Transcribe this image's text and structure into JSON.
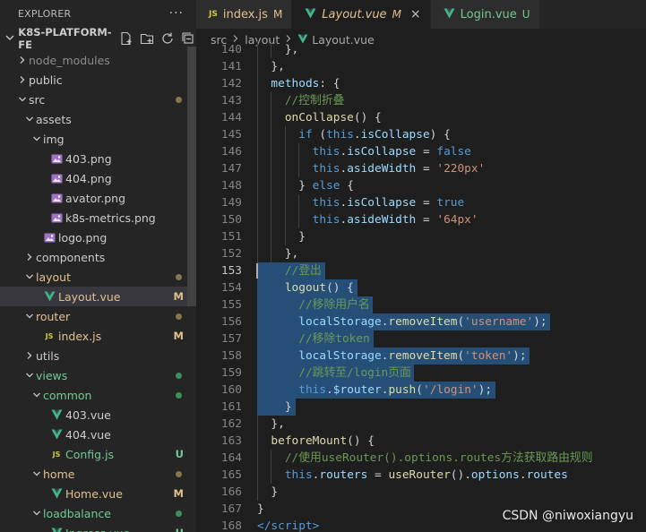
{
  "sidebar": {
    "title": "EXPLORER",
    "more": "···",
    "project": "K8S-PLATFORM-FE",
    "tree": [
      {
        "label": "node_modules",
        "depth": 1,
        "kind": "folder",
        "open": false,
        "color": "#8c8c8c"
      },
      {
        "label": "public",
        "depth": 1,
        "kind": "folder",
        "open": false,
        "color": "#cccccc"
      },
      {
        "label": "src",
        "depth": 1,
        "kind": "folder",
        "open": true,
        "color": "#cccccc",
        "dot": "#8c7350"
      },
      {
        "label": "assets",
        "depth": 2,
        "kind": "folder",
        "open": true,
        "color": "#cccccc"
      },
      {
        "label": "img",
        "depth": 3,
        "kind": "folder",
        "open": true,
        "color": "#cccccc"
      },
      {
        "label": "403.png",
        "depth": 4,
        "kind": "image",
        "color": "#cccccc"
      },
      {
        "label": "404.png",
        "depth": 4,
        "kind": "image",
        "color": "#cccccc"
      },
      {
        "label": "avator.png",
        "depth": 4,
        "kind": "image",
        "color": "#cccccc"
      },
      {
        "label": "k8s-metrics.png",
        "depth": 4,
        "kind": "image",
        "color": "#cccccc"
      },
      {
        "label": "logo.png",
        "depth": 3,
        "kind": "image",
        "color": "#cccccc"
      },
      {
        "label": "components",
        "depth": 2,
        "kind": "folder",
        "open": false,
        "color": "#cccccc"
      },
      {
        "label": "layout",
        "depth": 2,
        "kind": "folder",
        "open": true,
        "color": "#e2c08d",
        "dot": "#8c7350"
      },
      {
        "label": "Layout.vue",
        "depth": 3,
        "kind": "vue",
        "color": "#e2c08d",
        "badge": "M",
        "badgeColor": "#e2c08d",
        "selected": true
      },
      {
        "label": "router",
        "depth": 2,
        "kind": "folder",
        "open": true,
        "color": "#e2c08d",
        "dot": "#8c7350"
      },
      {
        "label": "index.js",
        "depth": 3,
        "kind": "js",
        "color": "#e2c08d",
        "badge": "M",
        "badgeColor": "#e2c08d"
      },
      {
        "label": "utils",
        "depth": 2,
        "kind": "folder",
        "open": false,
        "color": "#cccccc"
      },
      {
        "label": "views",
        "depth": 2,
        "kind": "folder",
        "open": true,
        "color": "#73c991",
        "dot": "#3f8f5a"
      },
      {
        "label": "common",
        "depth": 3,
        "kind": "folder",
        "open": true,
        "color": "#73c991",
        "dot": "#3f8f5a"
      },
      {
        "label": "403.vue",
        "depth": 4,
        "kind": "vue",
        "color": "#cccccc"
      },
      {
        "label": "404.vue",
        "depth": 4,
        "kind": "vue",
        "color": "#cccccc"
      },
      {
        "label": "Config.js",
        "depth": 4,
        "kind": "js",
        "color": "#73c991",
        "badge": "U",
        "badgeColor": "#73c991"
      },
      {
        "label": "home",
        "depth": 3,
        "kind": "folder",
        "open": true,
        "color": "#e2c08d",
        "dot": "#8c7350"
      },
      {
        "label": "Home.vue",
        "depth": 4,
        "kind": "vue",
        "color": "#e2c08d",
        "badge": "M",
        "badgeColor": "#e2c08d"
      },
      {
        "label": "loadbalance",
        "depth": 3,
        "kind": "folder",
        "open": true,
        "color": "#73c991",
        "dot": "#3f8f5a"
      },
      {
        "label": "Ingress.vue",
        "depth": 4,
        "kind": "vue",
        "color": "#73c991",
        "badge": "U",
        "badgeColor": "#73c991"
      }
    ]
  },
  "tabs": [
    {
      "label": "index.js",
      "status": "M",
      "icon": "js",
      "active": false,
      "italic": false
    },
    {
      "label": "Layout.vue",
      "status": "M",
      "icon": "vue",
      "active": true,
      "italic": true,
      "close": "×"
    },
    {
      "label": "Login.vue",
      "status": "U",
      "icon": "vue",
      "active": false,
      "italic": false
    }
  ],
  "breadcrumb": {
    "parts": [
      "src",
      "layout",
      "Layout.vue"
    ]
  },
  "colors": {
    "keyword": "#569cd6",
    "function": "#dcdcaa",
    "variable": "#9cdcfe",
    "string": "#ce9178",
    "comment": "#6a9955",
    "plain": "#d4d4d4",
    "selection": "#264f78",
    "modified": "#e2c08d",
    "untracked": "#73c991"
  },
  "code": {
    "first_line": 140,
    "lines": [
      {
        "n": 140,
        "indent": 2,
        "tokens": [
          [
            "pl",
            "},"
          ]
        ]
      },
      {
        "n": 141,
        "indent": 1,
        "tokens": [
          [
            "pl",
            "},"
          ]
        ]
      },
      {
        "n": 142,
        "indent": 1,
        "tokens": [
          [
            "var",
            "methods"
          ],
          [
            "pl",
            ": {"
          ]
        ]
      },
      {
        "n": 143,
        "indent": 2,
        "tokens": [
          [
            "cm",
            "//控制折叠"
          ]
        ]
      },
      {
        "n": 144,
        "indent": 2,
        "tokens": [
          [
            "fn",
            "onCollapse"
          ],
          [
            "pl",
            "() {"
          ]
        ]
      },
      {
        "n": 145,
        "indent": 3,
        "tokens": [
          [
            "kw",
            "if"
          ],
          [
            "pl",
            " ("
          ],
          [
            "kw",
            "this"
          ],
          [
            "pl",
            "."
          ],
          [
            "var",
            "isCollapse"
          ],
          [
            "pl",
            ") {"
          ]
        ]
      },
      {
        "n": 146,
        "indent": 4,
        "tokens": [
          [
            "kw",
            "this"
          ],
          [
            "pl",
            "."
          ],
          [
            "var",
            "isCollapse"
          ],
          [
            "pl",
            " = "
          ],
          [
            "kw",
            "false"
          ]
        ]
      },
      {
        "n": 147,
        "indent": 4,
        "tokens": [
          [
            "kw",
            "this"
          ],
          [
            "pl",
            "."
          ],
          [
            "var",
            "asideWidth"
          ],
          [
            "pl",
            " = "
          ],
          [
            "str",
            "'220px'"
          ]
        ]
      },
      {
        "n": 148,
        "indent": 3,
        "tokens": [
          [
            "pl",
            "} "
          ],
          [
            "kw",
            "else"
          ],
          [
            "pl",
            " {"
          ]
        ]
      },
      {
        "n": 149,
        "indent": 4,
        "tokens": [
          [
            "kw",
            "this"
          ],
          [
            "pl",
            "."
          ],
          [
            "var",
            "isCollapse"
          ],
          [
            "pl",
            " = "
          ],
          [
            "kw",
            "true"
          ]
        ]
      },
      {
        "n": 150,
        "indent": 4,
        "tokens": [
          [
            "kw",
            "this"
          ],
          [
            "pl",
            "."
          ],
          [
            "var",
            "asideWidth"
          ],
          [
            "pl",
            " = "
          ],
          [
            "str",
            "'64px'"
          ]
        ]
      },
      {
        "n": 151,
        "indent": 3,
        "tokens": [
          [
            "pl",
            "}"
          ]
        ]
      },
      {
        "n": 152,
        "indent": 2,
        "tokens": [
          [
            "pl",
            "},"
          ]
        ]
      },
      {
        "n": 153,
        "indent": 2,
        "tokens": [
          [
            "cm",
            "//登出"
          ]
        ],
        "selected": true
      },
      {
        "n": 154,
        "indent": 2,
        "tokens": [
          [
            "fn",
            "logout"
          ],
          [
            "pl",
            "() {"
          ]
        ],
        "selected": true
      },
      {
        "n": 155,
        "indent": 3,
        "tokens": [
          [
            "cm",
            "//移除用户名"
          ]
        ],
        "selected": true
      },
      {
        "n": 156,
        "indent": 3,
        "tokens": [
          [
            "var",
            "localStorage"
          ],
          [
            "pl",
            "."
          ],
          [
            "fn",
            "removeItem"
          ],
          [
            "pl",
            "("
          ],
          [
            "str",
            "'username'"
          ],
          [
            "pl",
            ");"
          ]
        ],
        "selected": true
      },
      {
        "n": 157,
        "indent": 3,
        "tokens": [
          [
            "cm",
            "//移除token"
          ]
        ],
        "selected": true
      },
      {
        "n": 158,
        "indent": 3,
        "tokens": [
          [
            "var",
            "localStorage"
          ],
          [
            "pl",
            "."
          ],
          [
            "fn",
            "removeItem"
          ],
          [
            "pl",
            "("
          ],
          [
            "str",
            "'token'"
          ],
          [
            "pl",
            ");"
          ]
        ],
        "selected": true
      },
      {
        "n": 159,
        "indent": 3,
        "tokens": [
          [
            "cm",
            "//跳转至/login页面"
          ]
        ],
        "selected": true
      },
      {
        "n": 160,
        "indent": 3,
        "tokens": [
          [
            "kw",
            "this"
          ],
          [
            "pl",
            "."
          ],
          [
            "var",
            "$router"
          ],
          [
            "pl",
            "."
          ],
          [
            "fn",
            "push"
          ],
          [
            "pl",
            "("
          ],
          [
            "str",
            "'/login'"
          ],
          [
            "pl",
            ");"
          ]
        ],
        "selected": true
      },
      {
        "n": 161,
        "indent": 2,
        "tokens": [
          [
            "pl",
            "}"
          ]
        ],
        "selected": true
      },
      {
        "n": 162,
        "indent": 1,
        "tokens": [
          [
            "pl",
            "},"
          ]
        ]
      },
      {
        "n": 163,
        "indent": 1,
        "tokens": [
          [
            "fn",
            "beforeMount"
          ],
          [
            "pl",
            "() {"
          ]
        ]
      },
      {
        "n": 164,
        "indent": 2,
        "tokens": [
          [
            "cm",
            "//使用useRouter().options.routes方法获取路由规则"
          ]
        ]
      },
      {
        "n": 165,
        "indent": 2,
        "tokens": [
          [
            "kw",
            "this"
          ],
          [
            "pl",
            "."
          ],
          [
            "var",
            "routers"
          ],
          [
            "pl",
            " = "
          ],
          [
            "fn",
            "useRouter"
          ],
          [
            "pl",
            "()."
          ],
          [
            "var",
            "options"
          ],
          [
            "pl",
            "."
          ],
          [
            "var",
            "routes"
          ]
        ]
      },
      {
        "n": 166,
        "indent": 1,
        "tokens": [
          [
            "pl",
            "}"
          ]
        ]
      },
      {
        "n": 167,
        "indent": 0,
        "tokens": [
          [
            "pl",
            "}"
          ]
        ]
      },
      {
        "n": 168,
        "indent": 0,
        "tokens": [
          [
            "kw",
            "</"
          ],
          [
            "kw",
            "script"
          ],
          [
            "kw",
            ">"
          ]
        ]
      }
    ],
    "current_line": 153
  },
  "watermark": "CSDN @niwoxiangyu"
}
